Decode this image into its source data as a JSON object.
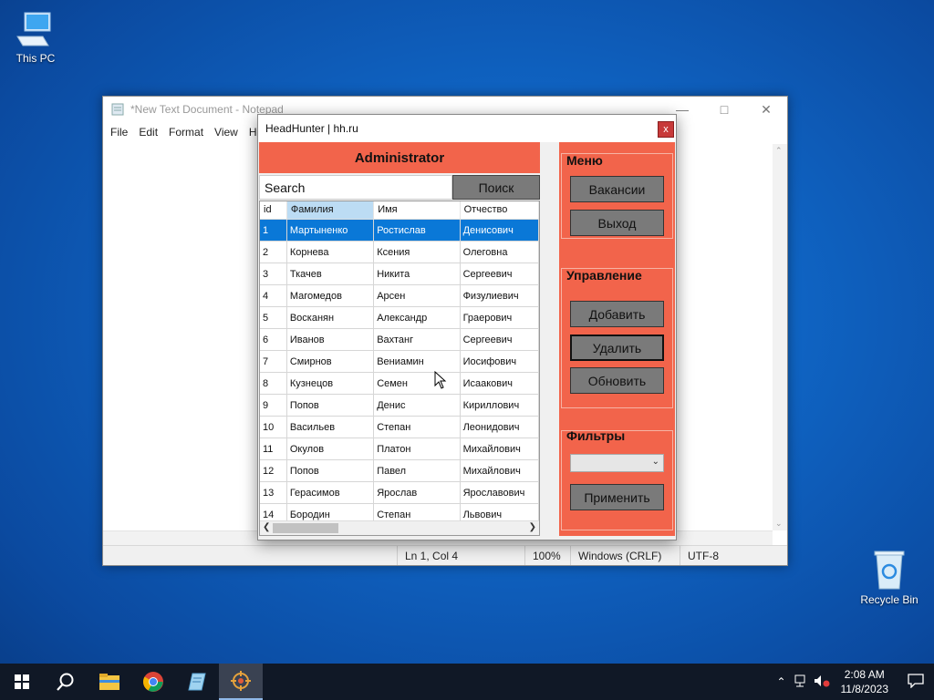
{
  "desktop": {
    "icons": [
      {
        "label": "This PC"
      },
      {
        "label": "Recycle Bin"
      }
    ]
  },
  "notepad": {
    "title": "*New Text Document - Notepad",
    "menu": [
      "File",
      "Edit",
      "Format",
      "View",
      "H"
    ],
    "status": {
      "position": "Ln 1, Col 4",
      "zoom": "100%",
      "line_ending": "Windows (CRLF)",
      "encoding": "UTF-8"
    }
  },
  "app": {
    "title": "HeadHunter | hh.ru",
    "close_label": "x",
    "banner": "Administrator",
    "search": {
      "value": "Search",
      "button": "Поиск"
    },
    "grid": {
      "columns": [
        "id",
        "Фамилия",
        "Имя",
        "Отчество"
      ],
      "rows": [
        [
          "1",
          "Мартыненко",
          "Ростислав",
          "Денисович"
        ],
        [
          "2",
          "Корнева",
          "Ксения",
          "Олеговна"
        ],
        [
          "3",
          "Ткачев",
          "Никита",
          "Сергеевич"
        ],
        [
          "4",
          "Магомедов",
          "Арсен",
          "Физулиевич"
        ],
        [
          "5",
          "Восканян",
          "Александр",
          "Граерович"
        ],
        [
          "6",
          "Иванов",
          "Вахтанг",
          "Сергеевич"
        ],
        [
          "7",
          "Смирнов",
          "Вениамин",
          "Иосифович"
        ],
        [
          "8",
          "Кузнецов",
          "Семен",
          "Исаакович"
        ],
        [
          "9",
          "Попов",
          "Денис",
          "Кириллович"
        ],
        [
          "10",
          "Васильев",
          "Степан",
          "Леонидович"
        ],
        [
          "11",
          "Окулов",
          "Платон",
          "Михайлович"
        ],
        [
          "12",
          "Попов",
          "Павел",
          "Михайлович"
        ],
        [
          "13",
          "Герасимов",
          "Ярослав",
          "Ярославович"
        ],
        [
          "14",
          "Бородин",
          "Степан",
          "Львович"
        ]
      ],
      "selected_row": 1
    },
    "panel": {
      "menu_title": "Меню",
      "menu_buttons": [
        "Вакансии",
        "Выход"
      ],
      "manage_title": "Управление",
      "manage_buttons": [
        "Добавить",
        "Удалить",
        "Обновить"
      ],
      "filters_title": "Фильтры",
      "filter_selected": "",
      "apply_button": "Применить"
    },
    "colors": {
      "accent": "#f2644b",
      "button": "#7a7a7a",
      "selection": "#0a78d7"
    }
  },
  "taskbar": {
    "time": "2:08 AM",
    "date": "11/8/2023"
  }
}
